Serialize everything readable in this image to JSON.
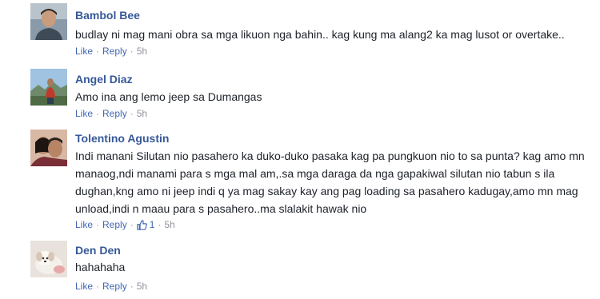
{
  "comments": [
    {
      "author": "Bambol Bee",
      "text": "budlay ni mag mani obra sa mga likuon nga bahin.. kag kung ma alang2 ka mag lusot or overtake..",
      "like_label": "Like",
      "reply_label": "Reply",
      "time": "5h",
      "avatar_icon": "profile-photo-man-dark-hair"
    },
    {
      "author": "Angel Diaz",
      "text": "Amo ina ang lemo jeep sa Dumangas",
      "like_label": "Like",
      "reply_label": "Reply",
      "time": "5h",
      "avatar_icon": "profile-photo-outdoor-mountains"
    },
    {
      "author": "Tolentino Agustin",
      "text": "Indi manani Silutan nio pasahero ka duko-duko pasaka kag pa pungkuon nio to sa punta? kag amo mn manaog,ndi manami para s mga mal am,.sa mga daraga da nga gapakiwal silutan nio tabun s ila dughan,kng amo ni jeep indi q ya mag sakay kay ang pag loading sa pasahero kadugay,amo mn mag unload,indi n maau para s pasahero..ma slalakit hawak nio",
      "like_label": "Like",
      "reply_label": "Reply",
      "reaction_count": "1",
      "reaction_icon": "thumbs-up-icon",
      "time": "5h",
      "avatar_icon": "profile-photo-couple"
    },
    {
      "author": "Den Den",
      "text": "hahahaha",
      "like_label": "Like",
      "reply_label": "Reply",
      "time": "5h",
      "avatar_icon": "profile-photo-puppy"
    }
  ],
  "colors": {
    "author_link": "#365899",
    "action_link": "#4267b2",
    "body_text": "#1d2129",
    "meta_text": "#90949c"
  }
}
